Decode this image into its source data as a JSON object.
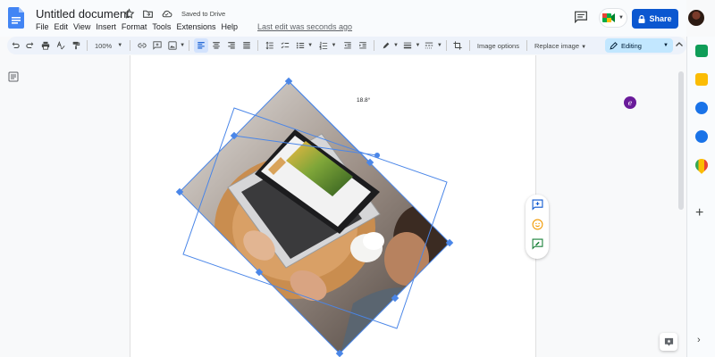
{
  "app": {
    "doc_title": "Untitled document",
    "saved_status": "Saved to Drive",
    "last_edit": "Last edit was seconds ago",
    "share_label": "Share"
  },
  "menu": [
    "File",
    "Edit",
    "View",
    "Insert",
    "Format",
    "Tools",
    "Extensions",
    "Help"
  ],
  "toolbar": {
    "zoom": "100%",
    "image_options": "Image options",
    "replace_image": "Replace image",
    "mode": "Editing"
  },
  "image": {
    "rotation_label": "18.8°",
    "rotation_degrees": 18.8
  },
  "colors": {
    "accent": "#0b57d0",
    "selection": "#4a86e8",
    "mode_bg": "#c2e7ff"
  },
  "icons": {
    "undo": "undo-icon",
    "redo": "redo-icon",
    "print": "print-icon",
    "spellcheck": "spellcheck-icon",
    "paint": "paint-format-icon",
    "link": "link-icon",
    "comment": "add-comment-icon",
    "image": "insert-image-icon"
  }
}
